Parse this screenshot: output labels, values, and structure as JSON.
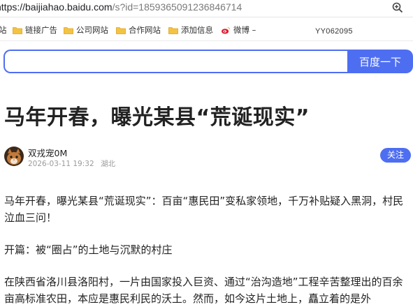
{
  "browser": {
    "url_host": "https://baijiahao.baidu.com",
    "url_rest": "/s?id=1859365091236846714",
    "zoom_icon": "zoom-in-icon"
  },
  "bookmarks": {
    "items": [
      {
        "label": "站",
        "icon": "folder-icon"
      },
      {
        "label": "链接广告",
        "icon": "folder-icon"
      },
      {
        "label": "公司网站",
        "icon": "folder-icon"
      },
      {
        "label": "合作网站",
        "icon": "folder-icon"
      },
      {
        "label": "添加信息",
        "icon": "folder-icon"
      },
      {
        "label": "微博 –",
        "icon": "weibo-icon"
      }
    ],
    "code": "YY062095"
  },
  "search": {
    "value": "",
    "button_label": "百度一下",
    "accent": "#4e6ef2"
  },
  "article": {
    "title": "马年开春，曝光某县“荒诞现实”",
    "author": "双戎宠0M",
    "date": "2026-03-11 19:32",
    "location": "湖北",
    "follow_label": "关注",
    "paragraphs": [
      "马年开春，曝光某县“荒诞现实”：百亩“惠民田”变私家领地，千万补贴疑入黑洞，村民泣血三问！",
      "开篇：被“圈占”的土地与沉默的村庄",
      "在陕西省洛川县洛阳村，一片由国家投入巨资、通过“治沟造地”工程辛苦整理出的百余亩高标准农田，本应是惠民利民的沃土。然而，如今这片土地上，矗立着的是外"
    ]
  }
}
